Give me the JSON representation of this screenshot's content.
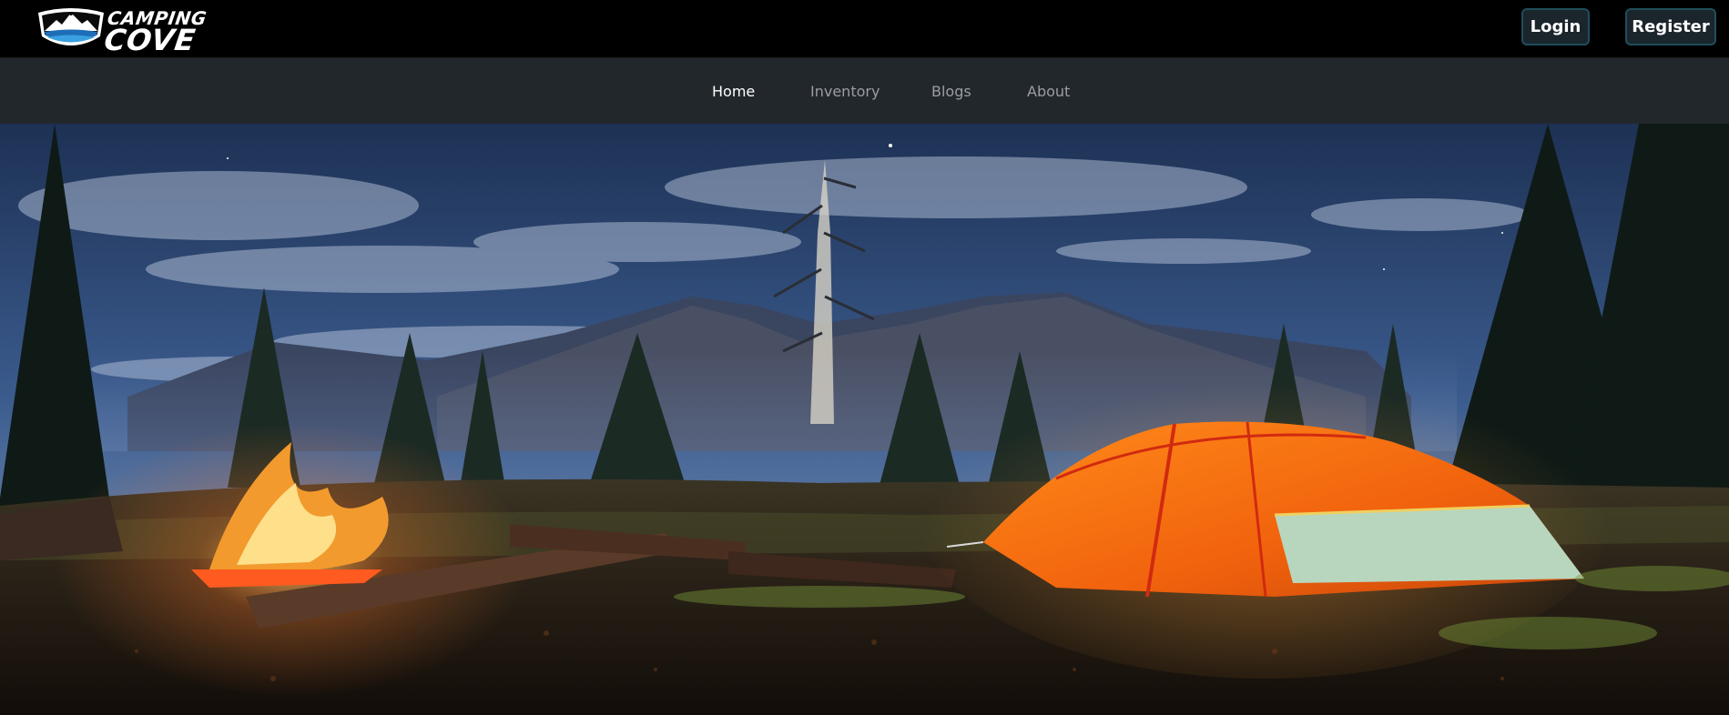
{
  "brand": {
    "line1": "CAMPING",
    "line2": "COVE",
    "icon": "mountain-shield-logo"
  },
  "header": {
    "login_label": "Login",
    "register_label": "Register"
  },
  "nav": {
    "items": [
      {
        "label": "Home",
        "active": true
      },
      {
        "label": "Inventory",
        "active": false
      },
      {
        "label": "Blogs",
        "active": false
      },
      {
        "label": "About",
        "active": false
      }
    ]
  },
  "colors": {
    "topbar": "#000000",
    "navbar": "#22272c",
    "button_bg": "#1b252c",
    "button_border": "#1f4f5c",
    "nav_active": "#ffffff",
    "nav_inactive": "#9a9ea3",
    "tent": "#f26a10"
  },
  "hero": {
    "scene": "hero-image"
  }
}
